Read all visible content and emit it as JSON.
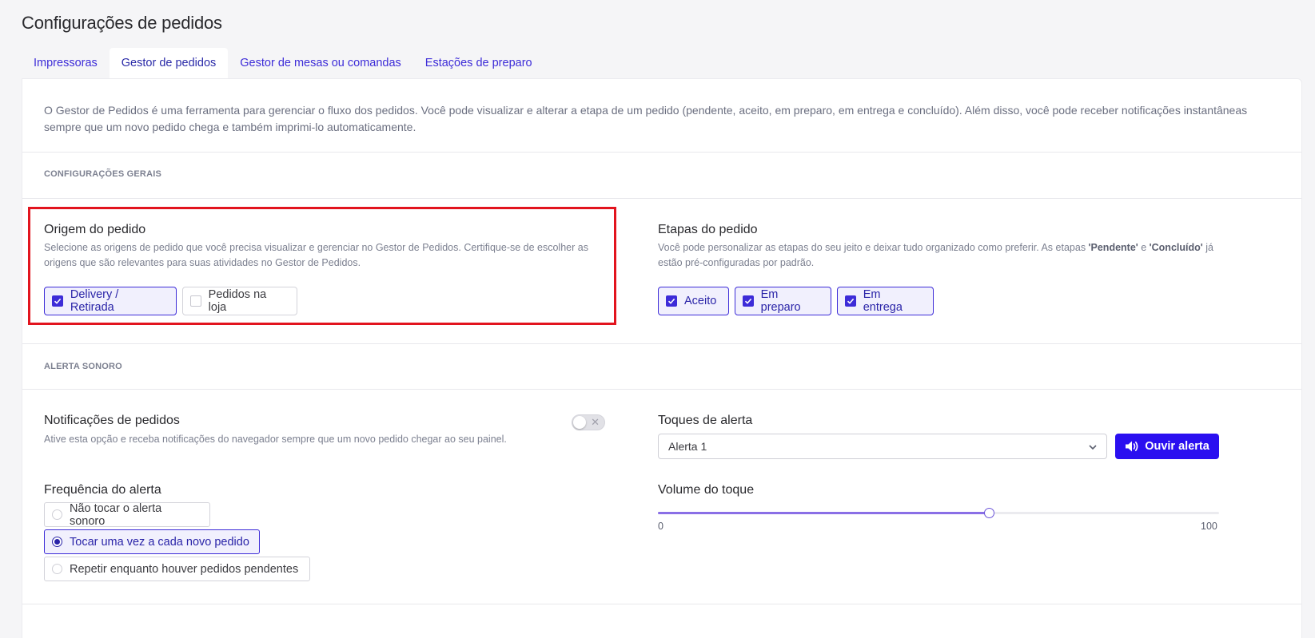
{
  "page_title": "Configurações de pedidos",
  "tabs": [
    {
      "label": "Impressoras",
      "active": false
    },
    {
      "label": "Gestor de pedidos",
      "active": true
    },
    {
      "label": "Gestor de mesas ou comandas",
      "active": false
    },
    {
      "label": "Estações de preparo",
      "active": false
    }
  ],
  "intro": "O Gestor de Pedidos é uma ferramenta para gerenciar o fluxo dos pedidos. Você pode visualizar e alterar a etapa de um pedido (pendente, aceito, em preparo, em entrega e concluído). Além disso, você pode receber notificações instantâneas sempre que um novo pedido chega e também imprimi-lo automaticamente.",
  "general": {
    "section_label": "CONFIGURAÇÕES GERAIS",
    "origem": {
      "title": "Origem do pedido",
      "description": "Selecione as origens de pedido que você precisa visualizar e gerenciar no Gestor de Pedidos. Certifique-se de escolher as origens que são relevantes para suas atividades no Gestor de Pedidos.",
      "options": [
        {
          "label": "Delivery / Retirada",
          "checked": true
        },
        {
          "label": "Pedidos na loja",
          "checked": false
        }
      ]
    },
    "etapas": {
      "title": "Etapas do pedido",
      "description_pre": "Você pode personalizar as etapas do seu jeito e deixar tudo organizado como preferir. As etapas ",
      "pendente": "'Pendente'",
      "e": " e ",
      "concluido": "'Concluído'",
      "description_post": " já estão pré-configuradas por padrão.",
      "options": [
        {
          "label": "Aceito",
          "checked": true
        },
        {
          "label": "Em preparo",
          "checked": true
        },
        {
          "label": "Em entrega",
          "checked": true
        }
      ]
    }
  },
  "alert": {
    "section_label": "ALERTA SONORO",
    "notifications": {
      "title": "Notificações de pedidos",
      "description": "Ative esta opção e receba notificações do navegador sempre que um novo pedido chegar ao seu painel.",
      "enabled": false
    },
    "toques": {
      "title": "Toques de alerta",
      "selected": "Alerta 1",
      "button_label": "Ouvir alerta"
    },
    "frequencia": {
      "title": "Frequência do alerta",
      "options": [
        {
          "label": "Não tocar o alerta sonoro",
          "selected": false
        },
        {
          "label": "Tocar uma vez a cada novo pedido",
          "selected": true
        },
        {
          "label": "Repetir enquanto houver pedidos pendentes",
          "selected": false
        }
      ]
    },
    "volume": {
      "title": "Volume do toque",
      "min": "0",
      "max": "100",
      "value": 59
    }
  }
}
